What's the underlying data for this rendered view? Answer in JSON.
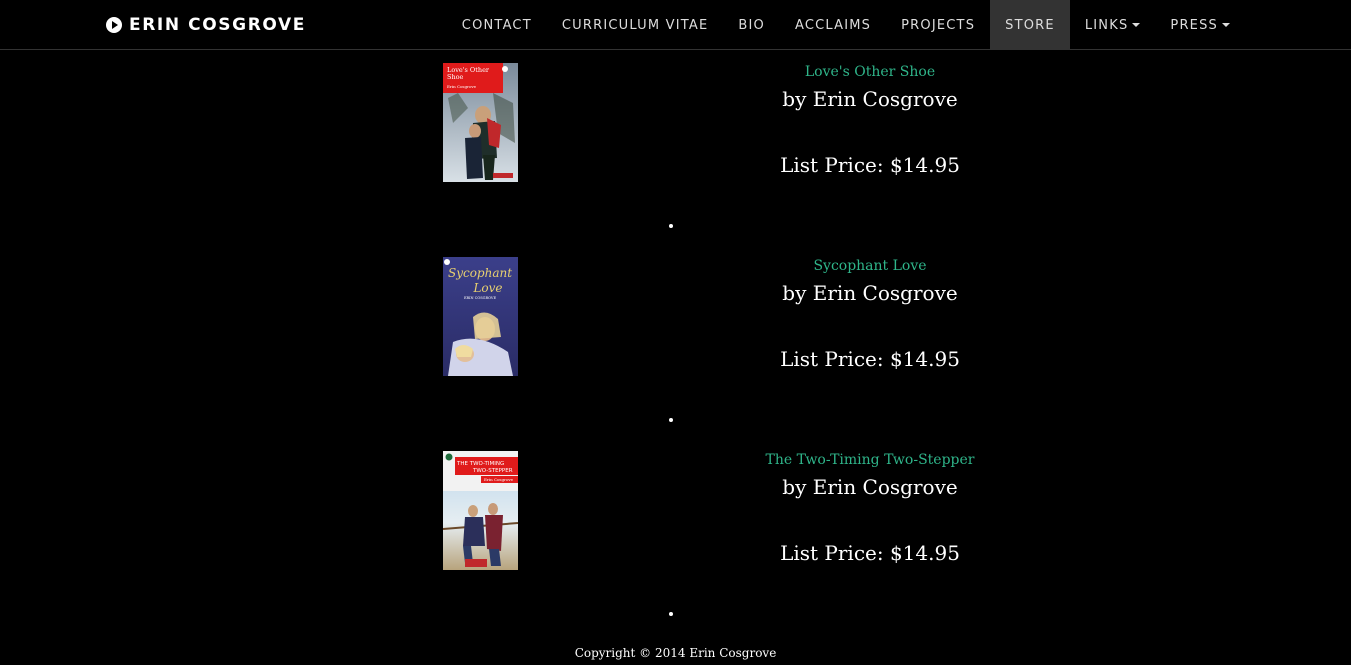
{
  "brand": {
    "name": "ERIN COSGROVE",
    "icon": "play-circle-icon"
  },
  "nav": {
    "items": [
      {
        "label": "CONTACT",
        "active": false,
        "dropdown": false
      },
      {
        "label": "CURRICULUM VITAE",
        "active": false,
        "dropdown": false
      },
      {
        "label": "BIO",
        "active": false,
        "dropdown": false
      },
      {
        "label": "ACCLAIMS",
        "active": false,
        "dropdown": false
      },
      {
        "label": "PROJECTS",
        "active": false,
        "dropdown": false
      },
      {
        "label": "STORE",
        "active": true,
        "dropdown": false
      },
      {
        "label": "LINKS",
        "active": false,
        "dropdown": true
      },
      {
        "label": "PRESS",
        "active": false,
        "dropdown": true
      }
    ]
  },
  "products": [
    {
      "title": "Love's Other Shoe",
      "author": "by Erin Cosgrove",
      "price": "List Price: $14.95",
      "cover_text": "Love's Other Shoe",
      "cover_author": "Erin Cosgrove"
    },
    {
      "title": "Sycophant Love",
      "author": "by Erin Cosgrove",
      "price": "List Price: $14.95",
      "cover_text": "Sycophant Love",
      "cover_author": "ERIN COSGROVE"
    },
    {
      "title": "The Two-Timing Two-Stepper",
      "author": "by Erin Cosgrove",
      "price": "List Price: $14.95",
      "cover_text": "THE TWO-TIMING TWO-STEPPER",
      "cover_author": "Erin Cosgrove"
    }
  ],
  "footer": {
    "copyright": "Copyright © 2014 Erin Cosgrove"
  },
  "colors": {
    "background": "#000000",
    "link": "#2fb58a",
    "active_nav_bg": "#333333"
  }
}
